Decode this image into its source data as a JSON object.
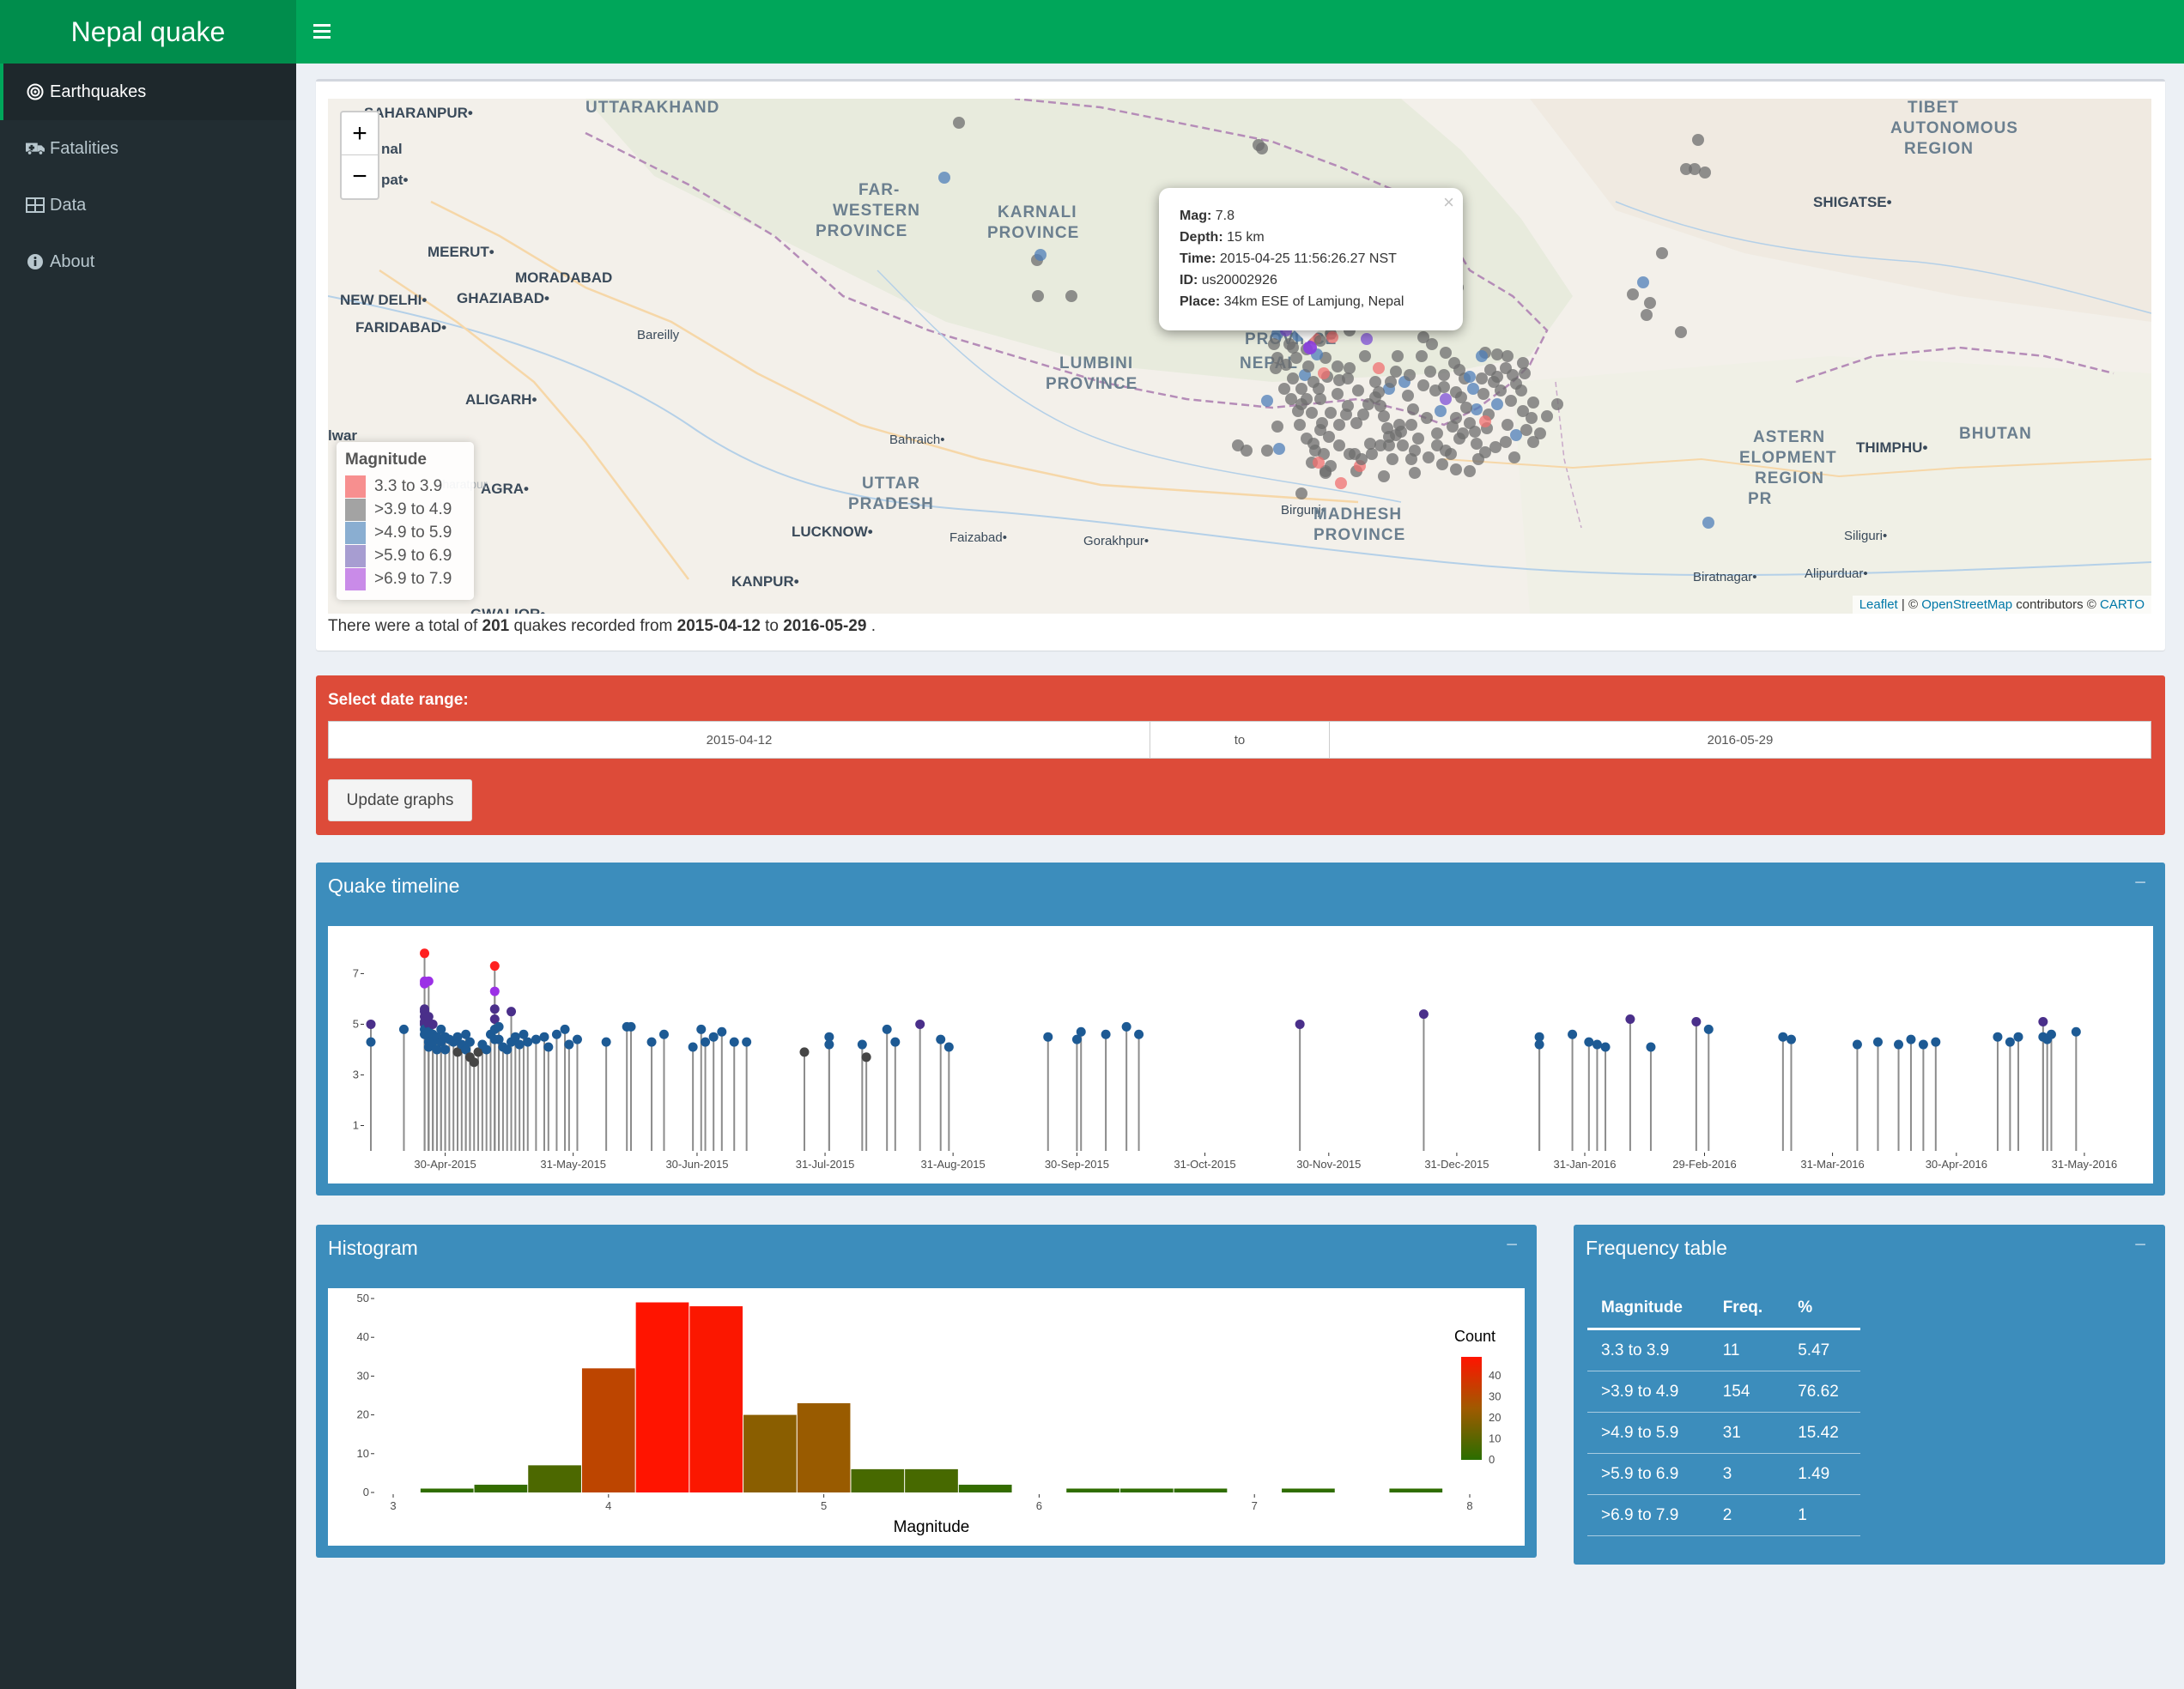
{
  "header": {
    "brand": "Nepal quake"
  },
  "sidebar": {
    "items": [
      {
        "label": "Earthquakes",
        "icon": "target-icon",
        "active": true
      },
      {
        "label": "Fatalities",
        "icon": "ambulance-icon",
        "active": false
      },
      {
        "label": "Data",
        "icon": "table-icon",
        "active": false
      },
      {
        "label": "About",
        "icon": "info-icon",
        "active": false
      }
    ]
  },
  "map": {
    "zoom_in": "+",
    "zoom_out": "−",
    "legend": {
      "title": "Magnitude",
      "items": [
        {
          "label": "3.3 to 3.9",
          "color": "#f78f8f"
        },
        {
          "label": ">3.9 to 4.9",
          "color": "#a3a3a3"
        },
        {
          "label": ">4.9 to 5.9",
          "color": "#8aaed1"
        },
        {
          "label": ">5.9 to 6.9",
          "color": "#a79dd1"
        },
        {
          "label": ">6.9 to 7.9",
          "color": "#c98be8"
        }
      ]
    },
    "popup": {
      "mag_label": "Mag:",
      "mag": "7.8",
      "depth_label": "Depth:",
      "depth": "15 km",
      "time_label": "Time:",
      "time": "2015-04-25 11:56:26.27 NST",
      "id_label": "ID:",
      "id": "us20002926",
      "place_label": "Place:",
      "place": "34km ESE of Lamjung, Nepal",
      "close": "×"
    },
    "attribution": {
      "leaflet": "Leaflet",
      "sep1": " | © ",
      "osm": "OpenStreetMap",
      "contrib": " contributors © ",
      "carto": "CARTO"
    },
    "labels": [
      "SAHARANPUR",
      "UTTARAKHAND",
      "nal",
      "pat",
      "MEERUT",
      "MORADABAD",
      "NEW DELHI",
      "GHAZIABAD",
      "FARIDABAD",
      "Bareilly",
      "ALIGARH",
      "lwar",
      "AGRA",
      "Bharatpur",
      "GWALIOR",
      "FAR-",
      "WESTERN",
      "PROVINCE",
      "KARNALI",
      "PROVINCE",
      "LUMBINI",
      "PROVINCE",
      "PROVINCE",
      "NEPAL",
      "UTTAR",
      "PRADESH",
      "Bahraich",
      "LUCKNOW",
      "KANPUR",
      "Faizabad",
      "Gorakhpur",
      "Birgunj",
      "MADHESH",
      "PROVINCE",
      "TIBET",
      "AUTONOMOUS",
      "REGION",
      "SHIGATSE",
      "ASTERN",
      "ELOPMENT",
      "REGION",
      "PR",
      "THIMPHU",
      "BHUTAN",
      "Siliguri",
      "Alipurduar",
      "Biratnagar"
    ]
  },
  "summary": {
    "prefix": "There were a total of ",
    "count": "201",
    "mid": " quakes recorded from ",
    "start": "2015-04-12",
    "to": " to ",
    "end": "2016-05-29",
    "suffix": " ."
  },
  "date_range": {
    "label": "Select date range:",
    "start": "2015-04-12",
    "separator": "to",
    "end": "2016-05-29",
    "button": "Update graphs"
  },
  "timeline": {
    "title": "Quake timeline",
    "collapse": "−"
  },
  "histogram": {
    "title": "Histogram",
    "collapse": "−"
  },
  "frequency": {
    "title": "Frequency table",
    "collapse": "−",
    "headers": [
      "Magnitude",
      "Freq.",
      "%"
    ],
    "rows": [
      [
        "3.3 to 3.9",
        "11",
        "5.47"
      ],
      [
        ">3.9 to 4.9",
        "154",
        "76.62"
      ],
      [
        ">4.9 to 5.9",
        "31",
        "15.42"
      ],
      [
        ">5.9 to 6.9",
        "3",
        "1.49"
      ],
      [
        ">6.9 to 7.9",
        "2",
        "1"
      ]
    ]
  },
  "chart_data": [
    {
      "type": "scatter",
      "title": "",
      "xlabel": "",
      "ylabel": "",
      "ylim": [
        0,
        8.2
      ],
      "y_ticks": [
        1,
        3,
        5,
        7
      ],
      "x_range": [
        "2015-04-12",
        "2016-06-05"
      ],
      "x_ticks": [
        "2015-04-30",
        "2015-05-31",
        "2015-06-30",
        "2015-07-31",
        "2015-08-31",
        "2015-09-30",
        "2015-10-31",
        "2015-11-30",
        "2015-12-31",
        "2016-01-31",
        "2016-02-29",
        "2016-03-31",
        "2016-04-30",
        "2016-05-31"
      ],
      "x_tick_labels": [
        "30-Apr-2015",
        "31-May-2015",
        "30-Jun-2015",
        "31-Jul-2015",
        "31-Aug-2015",
        "30-Sep-2015",
        "31-Oct-2015",
        "30-Nov-2015",
        "31-Dec-2015",
        "31-Jan-2016",
        "29-Feb-2016",
        "31-Mar-2016",
        "30-Apr-2016",
        "31-May-2016"
      ],
      "colors": {
        "low": "#454545",
        "mid": "#1d5a94",
        "high": "#4a2f8a",
        "major": "#9b30e6",
        "great": "#ff2020"
      },
      "points": [
        [
          "2015-04-12",
          4.3
        ],
        [
          "2015-04-12",
          5.0
        ],
        [
          "2015-04-20",
          4.8
        ],
        [
          "2015-04-25",
          7.8
        ],
        [
          "2015-04-25",
          6.6
        ],
        [
          "2015-04-25",
          6.7
        ],
        [
          "2015-04-25",
          5.6
        ],
        [
          "2015-04-25",
          5.5
        ],
        [
          "2015-04-25",
          5.3
        ],
        [
          "2015-04-25",
          5.1
        ],
        [
          "2015-04-25",
          5.0
        ],
        [
          "2015-04-25",
          4.8
        ],
        [
          "2015-04-25",
          4.6
        ],
        [
          "2015-04-26",
          6.7
        ],
        [
          "2015-04-26",
          5.3
        ],
        [
          "2015-04-26",
          5.0
        ],
        [
          "2015-04-26",
          4.7
        ],
        [
          "2015-04-26",
          4.5
        ],
        [
          "2015-04-26",
          4.3
        ],
        [
          "2015-04-26",
          4.1
        ],
        [
          "2015-04-27",
          5.0
        ],
        [
          "2015-04-27",
          4.6
        ],
        [
          "2015-04-27",
          4.3
        ],
        [
          "2015-04-28",
          4.5
        ],
        [
          "2015-04-28",
          4.0
        ],
        [
          "2015-04-29",
          4.8
        ],
        [
          "2015-04-29",
          4.3
        ],
        [
          "2015-04-30",
          4.5
        ],
        [
          "2015-04-30",
          4.0
        ],
        [
          "2015-05-01",
          4.4
        ],
        [
          "2015-05-02",
          4.3
        ],
        [
          "2015-05-03",
          3.9
        ],
        [
          "2015-05-03",
          4.5
        ],
        [
          "2015-05-04",
          4.2
        ],
        [
          "2015-05-05",
          4.0
        ],
        [
          "2015-05-05",
          4.6
        ],
        [
          "2015-05-06",
          3.7
        ],
        [
          "2015-05-06",
          4.3
        ],
        [
          "2015-05-07",
          3.5
        ],
        [
          "2015-05-08",
          3.9
        ],
        [
          "2015-05-09",
          4.2
        ],
        [
          "2015-05-10",
          4.0
        ],
        [
          "2015-05-11",
          4.6
        ],
        [
          "2015-05-12",
          7.3
        ],
        [
          "2015-05-12",
          6.3
        ],
        [
          "2015-05-12",
          5.6
        ],
        [
          "2015-05-12",
          5.2
        ],
        [
          "2015-05-12",
          4.8
        ],
        [
          "2015-05-12",
          4.4
        ],
        [
          "2015-05-13",
          4.9
        ],
        [
          "2015-05-13",
          4.4
        ],
        [
          "2015-05-14",
          4.1
        ],
        [
          "2015-05-15",
          4.0
        ],
        [
          "2015-05-16",
          5.5
        ],
        [
          "2015-05-16",
          4.3
        ],
        [
          "2015-05-17",
          4.5
        ],
        [
          "2015-05-18",
          4.2
        ],
        [
          "2015-05-19",
          4.6
        ],
        [
          "2015-05-20",
          4.3
        ],
        [
          "2015-05-22",
          4.4
        ],
        [
          "2015-05-24",
          4.5
        ],
        [
          "2015-05-25",
          4.1
        ],
        [
          "2015-05-27",
          4.6
        ],
        [
          "2015-05-29",
          4.8
        ],
        [
          "2015-05-30",
          4.2
        ],
        [
          "2015-06-01",
          4.4
        ],
        [
          "2015-06-08",
          4.3
        ],
        [
          "2015-06-13",
          4.9
        ],
        [
          "2015-06-14",
          4.9
        ],
        [
          "2015-06-19",
          4.3
        ],
        [
          "2015-06-22",
          4.6
        ],
        [
          "2015-06-29",
          4.1
        ],
        [
          "2015-07-01",
          4.8
        ],
        [
          "2015-07-02",
          4.3
        ],
        [
          "2015-07-04",
          4.5
        ],
        [
          "2015-07-06",
          4.7
        ],
        [
          "2015-07-09",
          4.3
        ],
        [
          "2015-07-12",
          4.3
        ],
        [
          "2015-07-26",
          3.9
        ],
        [
          "2015-08-01",
          4.5
        ],
        [
          "2015-08-01",
          4.2
        ],
        [
          "2015-08-09",
          4.2
        ],
        [
          "2015-08-10",
          3.7
        ],
        [
          "2015-08-15",
          4.8
        ],
        [
          "2015-08-17",
          4.3
        ],
        [
          "2015-08-23",
          5.0
        ],
        [
          "2015-08-28",
          4.4
        ],
        [
          "2015-08-30",
          4.1
        ],
        [
          "2015-09-23",
          4.5
        ],
        [
          "2015-09-30",
          4.4
        ],
        [
          "2015-10-01",
          4.7
        ],
        [
          "2015-10-07",
          4.6
        ],
        [
          "2015-10-12",
          4.9
        ],
        [
          "2015-10-15",
          4.6
        ],
        [
          "2015-11-23",
          5.0
        ],
        [
          "2015-12-23",
          5.4
        ],
        [
          "2016-01-20",
          4.5
        ],
        [
          "2016-01-20",
          4.2
        ],
        [
          "2016-01-28",
          4.6
        ],
        [
          "2016-02-01",
          4.3
        ],
        [
          "2016-02-03",
          4.2
        ],
        [
          "2016-02-05",
          4.1
        ],
        [
          "2016-02-11",
          5.2
        ],
        [
          "2016-02-16",
          4.1
        ],
        [
          "2016-02-27",
          5.1
        ],
        [
          "2016-03-01",
          4.8
        ],
        [
          "2016-03-19",
          4.5
        ],
        [
          "2016-03-21",
          4.4
        ],
        [
          "2016-04-06",
          4.2
        ],
        [
          "2016-04-11",
          4.3
        ],
        [
          "2016-04-16",
          4.2
        ],
        [
          "2016-04-19",
          4.4
        ],
        [
          "2016-04-22",
          4.2
        ],
        [
          "2016-04-25",
          4.3
        ],
        [
          "2016-05-10",
          4.5
        ],
        [
          "2016-05-13",
          4.3
        ],
        [
          "2016-05-15",
          4.5
        ],
        [
          "2016-05-21",
          5.1
        ],
        [
          "2016-05-21",
          4.5
        ],
        [
          "2016-05-22",
          4.4
        ],
        [
          "2016-05-23",
          4.6
        ],
        [
          "2016-05-29",
          4.7
        ]
      ]
    },
    {
      "type": "bar",
      "title": "",
      "xlabel": "Magnitude",
      "ylabel": "",
      "xlim": [
        3,
        8
      ],
      "ylim": [
        0,
        50
      ],
      "x_ticks": [
        3,
        4,
        5,
        6,
        7,
        8
      ],
      "y_ticks": [
        0,
        10,
        20,
        30,
        40,
        50
      ],
      "bin_width": 0.25,
      "legend_title": "Count",
      "legend_ticks": [
        0,
        10,
        20,
        30,
        40
      ],
      "bins": [
        {
          "x0": 3.125,
          "count": 1
        },
        {
          "x0": 3.375,
          "count": 2
        },
        {
          "x0": 3.625,
          "count": 7
        },
        {
          "x0": 3.875,
          "count": 32
        },
        {
          "x0": 4.125,
          "count": 49
        },
        {
          "x0": 4.375,
          "count": 48
        },
        {
          "x0": 4.625,
          "count": 20
        },
        {
          "x0": 4.875,
          "count": 23
        },
        {
          "x0": 5.125,
          "count": 6
        },
        {
          "x0": 5.375,
          "count": 6
        },
        {
          "x0": 5.625,
          "count": 2
        },
        {
          "x0": 5.875,
          "count": 0
        },
        {
          "x0": 6.125,
          "count": 1
        },
        {
          "x0": 6.375,
          "count": 1
        },
        {
          "x0": 6.625,
          "count": 1
        },
        {
          "x0": 6.875,
          "count": 0
        },
        {
          "x0": 7.125,
          "count": 1
        },
        {
          "x0": 7.375,
          "count": 0
        },
        {
          "x0": 7.625,
          "count": 1
        }
      ]
    }
  ]
}
